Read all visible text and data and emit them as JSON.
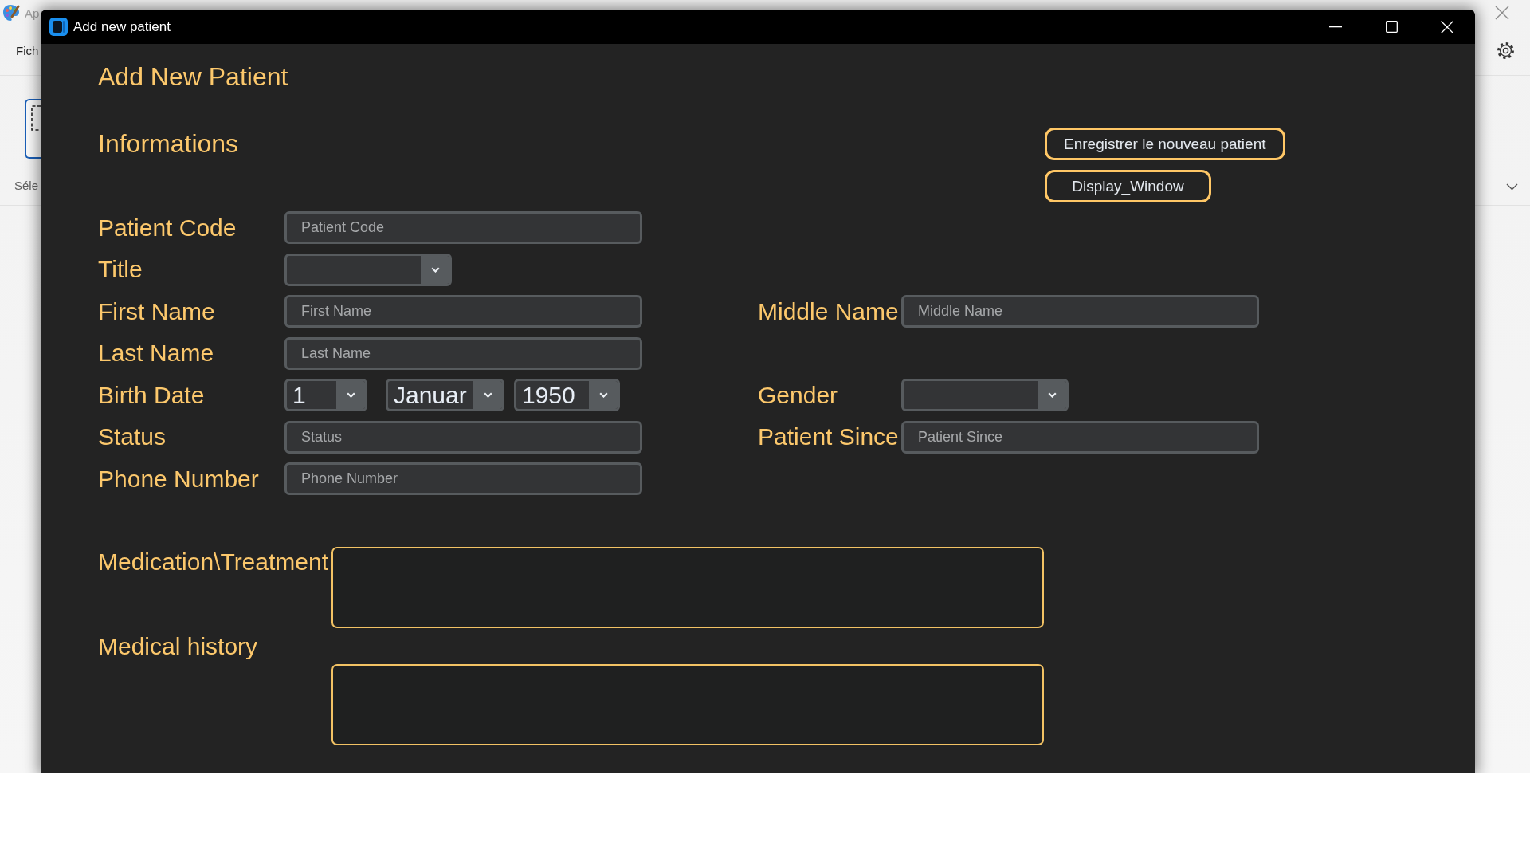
{
  "background_window": {
    "title": "Ap",
    "menu": [
      "Fich"
    ],
    "tool_label": "Séle"
  },
  "window": {
    "title": "Add new patient"
  },
  "heading": "Add New Patient",
  "section_title": "Informations",
  "buttons": [
    "Enregistrer le nouveau patient",
    "Display_Window"
  ],
  "rows": [
    {
      "fields": [
        {
          "kind": "text",
          "label": "Patient Code",
          "placeholder": "Patient Code"
        }
      ]
    },
    {
      "fields": [
        {
          "kind": "select",
          "label": "Title"
        }
      ]
    },
    {
      "fields": [
        {
          "kind": "text",
          "label": "First Name",
          "placeholder": "First Name"
        },
        {
          "kind": "text",
          "label": "Middle Name",
          "placeholder": "Middle Name"
        }
      ]
    },
    {
      "fields": [
        {
          "kind": "text",
          "label": "Last Name",
          "placeholder": "Last Name"
        }
      ]
    },
    {
      "fields": [
        {
          "kind": "date",
          "label": "Birth Date",
          "values": [
            "1",
            "Januar",
            "1950"
          ]
        },
        {
          "kind": "select",
          "label": "Gender"
        }
      ]
    },
    {
      "fields": [
        {
          "kind": "text",
          "label": "Status",
          "placeholder": "Status"
        },
        {
          "kind": "text",
          "label": "Patient Since",
          "placeholder": "Patient Since"
        }
      ]
    },
    {
      "fields": [
        {
          "kind": "text",
          "label": "Phone Number",
          "placeholder": "Phone Number"
        }
      ]
    }
  ],
  "notes": [
    {
      "label": "Medication\\Treatment"
    },
    {
      "label": "Medical history"
    }
  ]
}
